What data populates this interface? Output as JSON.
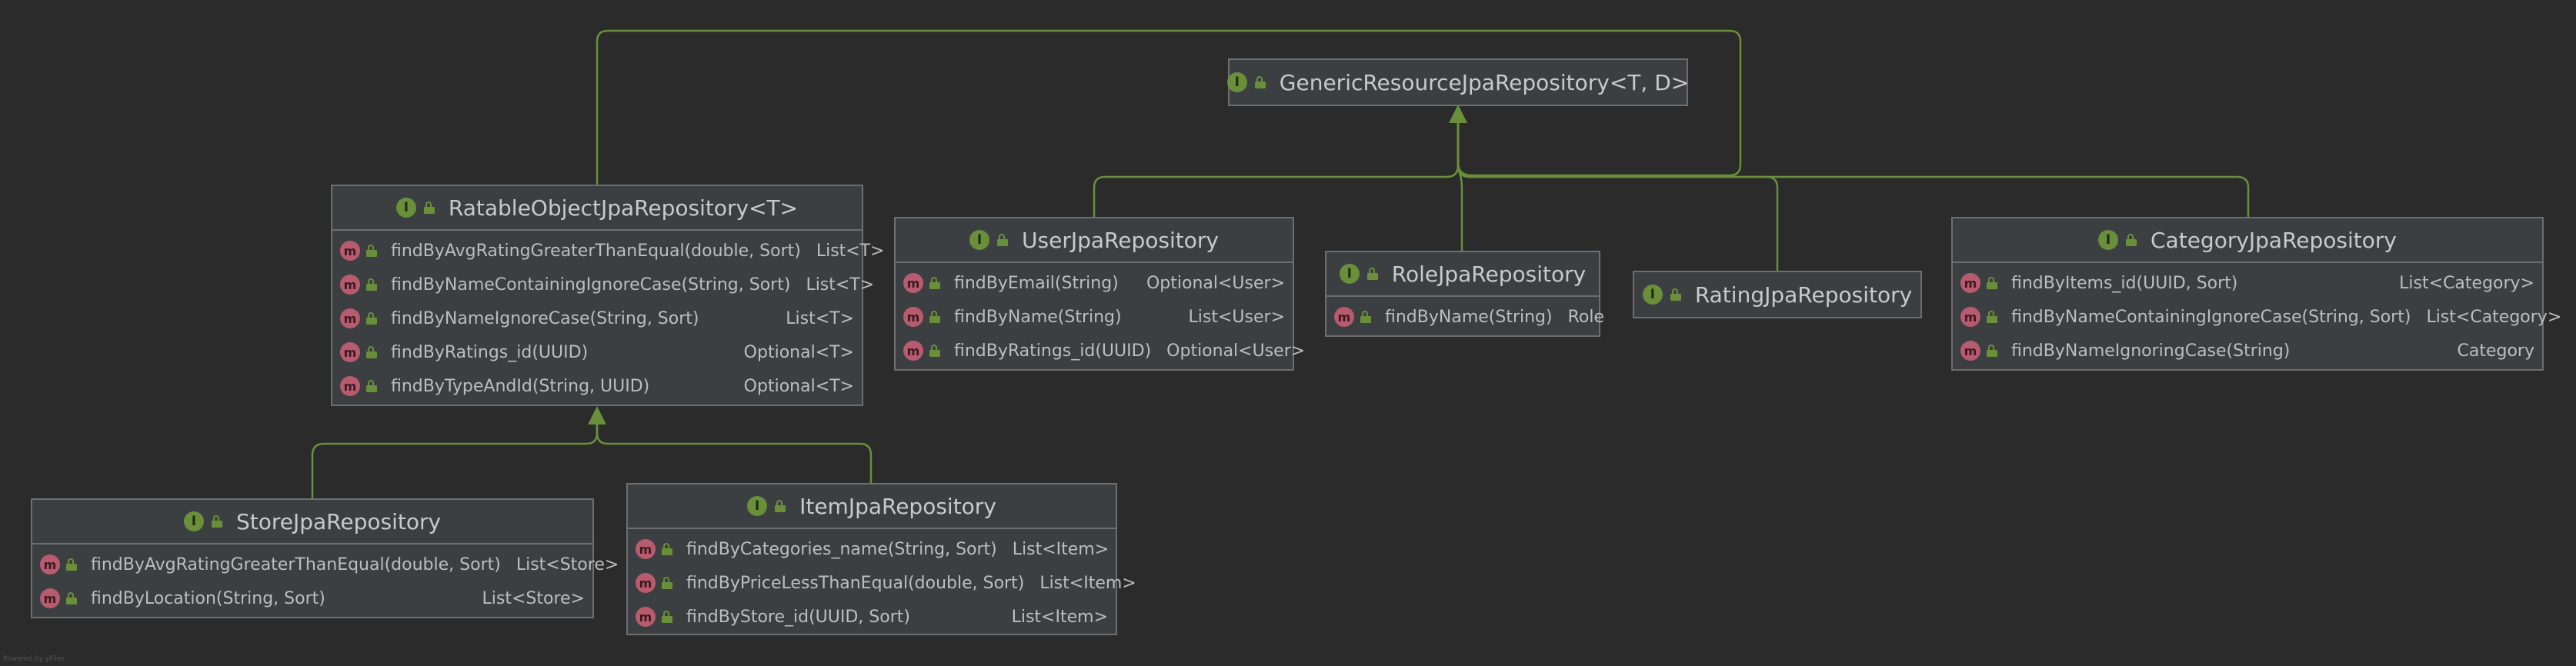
{
  "interfaces": {
    "generic": {
      "title": "GenericResourceJpaRepository<T, D>",
      "methods": []
    },
    "ratable": {
      "title": "RatableObjectJpaRepository<T>",
      "methods": [
        {
          "name": "findByAvgRatingGreaterThanEqual(double, Sort)",
          "ret": "List<T>"
        },
        {
          "name": "findByNameContainingIgnoreCase(String, Sort)",
          "ret": "List<T>"
        },
        {
          "name": "findByNameIgnoreCase(String, Sort)",
          "ret": "List<T>"
        },
        {
          "name": "findByRatings_id(UUID)",
          "ret": "Optional<T>"
        },
        {
          "name": "findByTypeAndId(String, UUID)",
          "ret": "Optional<T>"
        }
      ]
    },
    "user": {
      "title": "UserJpaRepository",
      "methods": [
        {
          "name": "findByEmail(String)",
          "ret": "Optional<User>"
        },
        {
          "name": "findByName(String)",
          "ret": "List<User>"
        },
        {
          "name": "findByRatings_id(UUID)",
          "ret": "Optional<User>"
        }
      ]
    },
    "role": {
      "title": "RoleJpaRepository",
      "methods": [
        {
          "name": "findByName(String)",
          "ret": "Role"
        }
      ]
    },
    "rating": {
      "title": "RatingJpaRepository",
      "methods": []
    },
    "category": {
      "title": "CategoryJpaRepository",
      "methods": [
        {
          "name": "findByItems_id(UUID, Sort)",
          "ret": "List<Category>"
        },
        {
          "name": "findByNameContainingIgnoreCase(String, Sort)",
          "ret": "List<Category>"
        },
        {
          "name": "findByNameIgnoringCase(String)",
          "ret": "Category"
        }
      ]
    },
    "store": {
      "title": "StoreJpaRepository",
      "methods": [
        {
          "name": "findByAvgRatingGreaterThanEqual(double, Sort)",
          "ret": "List<Store>"
        },
        {
          "name": "findByLocation(String, Sort)",
          "ret": "List<Store>"
        }
      ]
    },
    "item": {
      "title": "ItemJpaRepository",
      "methods": [
        {
          "name": "findByCategories_name(String, Sort)",
          "ret": "List<Item>"
        },
        {
          "name": "findByPriceLessThanEqual(double, Sort)",
          "ret": "List<Item>"
        },
        {
          "name": "findByStore_id(UUID, Sort)",
          "ret": "List<Item>"
        }
      ]
    }
  },
  "icons": {
    "interface_letter": "I",
    "method_letter": "m"
  },
  "colors": {
    "background": "#2b2b2b",
    "box": "#3c3f41",
    "border": "#6e6e6e",
    "connector": "#6a8f3a",
    "interface_icon": "#6a8f3a",
    "method_icon": "#b95b6e"
  },
  "footer": "Powered by yFiles"
}
